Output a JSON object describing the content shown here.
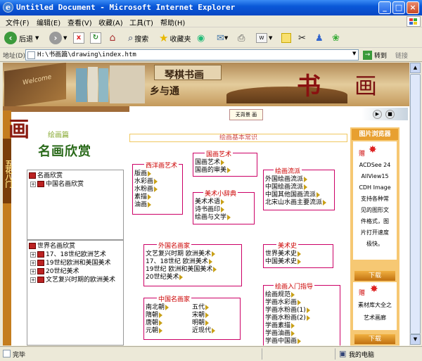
{
  "window": {
    "title": "Untitled Document - Microsoft Internet Explorer",
    "icon": "ie-icon"
  },
  "menubar": [
    "文件(F)",
    "编辑(E)",
    "查看(V)",
    "收藏(A)",
    "工具(T)",
    "帮助(H)"
  ],
  "toolbar": {
    "back": "后退",
    "search": "搜索",
    "favorites": "收藏夹"
  },
  "address": {
    "label": "地址(D)",
    "value": "H:\\书画篇\\drawing\\index.htm",
    "go": "转到",
    "links": "链接"
  },
  "banner": {
    "title_a": "琴棋书画",
    "title_b": "乡与通",
    "char_shu": "书",
    "char_hua": "画",
    "welcome": "Welcome"
  },
  "sidebar": {
    "logo_char": "画",
    "section_label": "绘画篇",
    "title": "名画欣赏",
    "vertical_label": "五花八门"
  },
  "top_button": "无背景 画",
  "top_nav_label": "绘画基本常识",
  "tree1": {
    "root": "名画欣赏",
    "items": [
      "中国名画欣赏"
    ]
  },
  "tree2": {
    "root": "世界名画欣赏",
    "items": [
      "17、18世纪欧洲艺术",
      "19世纪欧洲和美国美术",
      "20世纪美术",
      "文艺复兴时期的欧洲美术"
    ]
  },
  "boxes": {
    "western": {
      "title": "西洋画艺术",
      "items": [
        "版画",
        "水彩画",
        "水粉画",
        "素描",
        "油画"
      ]
    },
    "chinese_art": {
      "title": "国画艺术",
      "items": [
        "国画艺术",
        "国画的审美"
      ]
    },
    "dictionary": {
      "title": "美术小辞典",
      "items": [
        "美术术语",
        "诗书画印",
        "绘画与文学"
      ]
    },
    "schools": {
      "title": "绘画流派",
      "items": [
        "外国绘画流派",
        "中国绘画流派",
        "中国其他国画流派",
        "北宋山水画主要流派"
      ]
    },
    "foreign_masters": {
      "title": "外国名画家",
      "items": [
        "文艺复兴时期 欧洲美术",
        "17、18世纪 欧洲美术",
        "19世纪 欧洲和美国美术",
        "20世纪美术"
      ]
    },
    "art_history": {
      "title": "美术史",
      "items": [
        "世界美术史",
        "中国美术史"
      ]
    },
    "chinese_masters": {
      "title": "中国名画家",
      "col1": [
        "南北朝",
        "隋朝",
        "唐朝",
        "元朝"
      ],
      "col2": [
        "五代",
        "宋朝",
        "明朝",
        "近现代"
      ]
    },
    "intro": {
      "title": "绘画入门指导",
      "items": [
        "绘画规范",
        "学画水彩画",
        "学画水粉画(1)",
        "学画水粉画(2)",
        "学画素描",
        "学画油画",
        "学画中国画"
      ]
    }
  },
  "right_panel": {
    "header": "图片浏览器",
    "gift1": "赠",
    "lines": [
      "ACDSee 24",
      "AllView15",
      "CDH Image",
      "支持各种常",
      "见的图形文",
      "件格式，图",
      "片打开速度",
      "极快。"
    ],
    "download1": "下载",
    "gift2": "赠",
    "lines2": [
      "素材库大全之",
      "艺术画廊"
    ],
    "download2": "下载"
  },
  "status": {
    "text": "完毕",
    "zone": "我的电脑"
  },
  "colors": {
    "titlebar": "#0a58d8",
    "box_border": "#cc0066",
    "red_text": "#cc0000",
    "gold": "#f6c873"
  }
}
